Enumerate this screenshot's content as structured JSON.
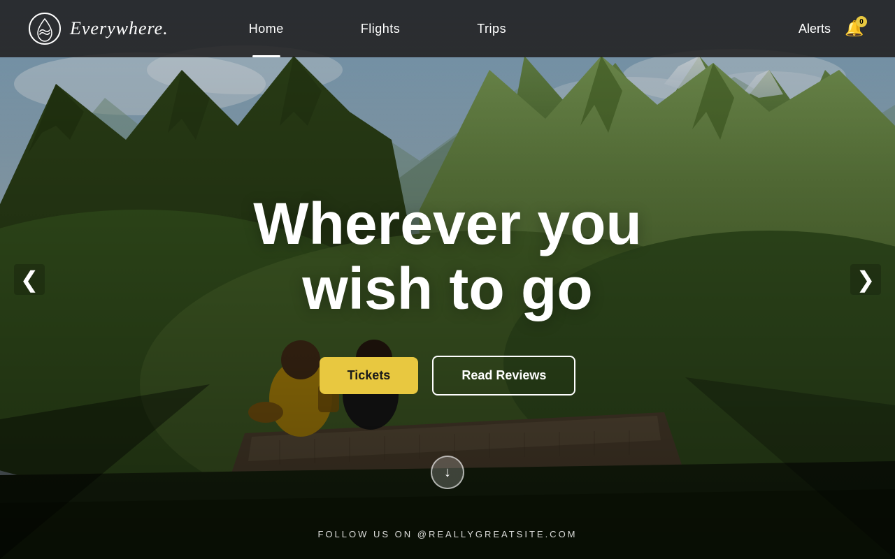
{
  "brand": {
    "name": "Everywhere.",
    "logo_aria": "Everywhere logo"
  },
  "nav": {
    "links": [
      {
        "label": "Home",
        "active": true
      },
      {
        "label": "Flights",
        "active": false
      },
      {
        "label": "Trips",
        "active": false
      }
    ],
    "alerts_label": "Alerts",
    "notification_count": "0"
  },
  "hero": {
    "title_line1": "Wherever you",
    "title_line2": "wish to go",
    "btn_tickets": "Tickets",
    "btn_reviews": "Read Reviews",
    "scroll_down_aria": "Scroll down",
    "footer_text": "FOLLOW US ON @REALLYGREATSITE.COM"
  },
  "carousel": {
    "prev_aria": "Previous slide",
    "next_aria": "Next slide",
    "prev_symbol": "❮",
    "next_symbol": "❯"
  }
}
